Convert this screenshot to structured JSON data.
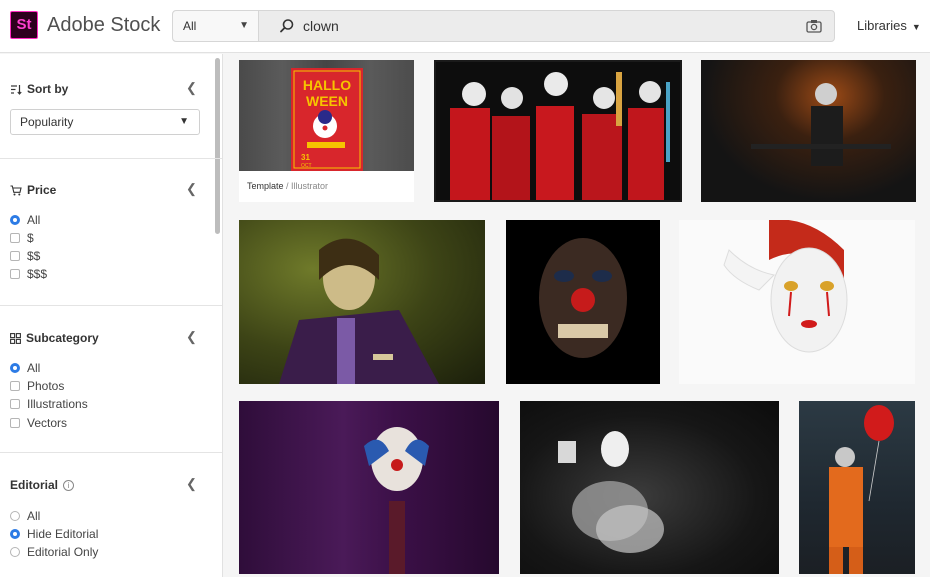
{
  "header": {
    "logo_text": "St",
    "brand": "Adobe Stock",
    "filter_value": "All",
    "search_value": "clown",
    "libraries_label": "Libraries"
  },
  "sidebar": {
    "sort": {
      "title": "Sort by",
      "value": "Popularity"
    },
    "price": {
      "title": "Price",
      "options": [
        "All",
        "$",
        "$$",
        "$$$"
      ],
      "selected": "All"
    },
    "subcategory": {
      "title": "Subcategory",
      "options": [
        "All",
        "Photos",
        "Illustrations",
        "Vectors"
      ],
      "selected": "All"
    },
    "editorial": {
      "title": "Editorial",
      "options": [
        "All",
        "Hide Editorial",
        "Editorial Only"
      ],
      "selected": "Hide Editorial"
    }
  },
  "results": {
    "template_caption": {
      "type": "Template",
      "separator": " / ",
      "app": "Illustrator"
    },
    "poster_text": {
      "line1": "HALLO",
      "line2": "WEEN",
      "date": "31",
      "month": "OCT"
    }
  },
  "colors": {
    "brand_bg": "#2d001e",
    "brand_accent": "#ff3fd0",
    "radio_selected": "#2c7be5",
    "poster_red": "#d8262c",
    "poster_yellow": "#f6c400"
  }
}
